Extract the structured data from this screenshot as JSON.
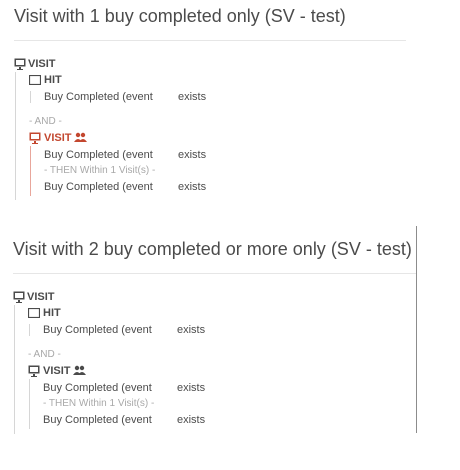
{
  "segment1": {
    "title": "Visit with 1 buy completed only (SV - test)",
    "visit_label": "VISIT",
    "hit_label": "HIT",
    "hit_row": {
      "text": "Buy Completed (event",
      "op": "exists"
    },
    "and_label": "- AND -",
    "visit2_label": "VISIT",
    "seq_rows": [
      {
        "text": "Buy Completed (event",
        "op": "exists"
      },
      {
        "text": "Buy Completed (event",
        "op": "exists"
      }
    ],
    "then_label": "- THEN Within 1 Visit(s) -",
    "accent": "#c3472f"
  },
  "segment2": {
    "title": "Visit with 2 buy completed or more only (SV - test)",
    "visit_label": "VISIT",
    "hit_label": "HIT",
    "hit_row": {
      "text": "Buy Completed (event",
      "op": "exists"
    },
    "and_label": "- AND -",
    "visit2_label": "VISIT",
    "seq_rows": [
      {
        "text": "Buy Completed (event",
        "op": "exists"
      },
      {
        "text": "Buy Completed (event",
        "op": "exists"
      }
    ],
    "then_label": "- THEN Within 1 Visit(s) -"
  },
  "icons": {
    "visit": "monitor-icon",
    "hit": "rectangle-icon",
    "group": "people-icon"
  }
}
